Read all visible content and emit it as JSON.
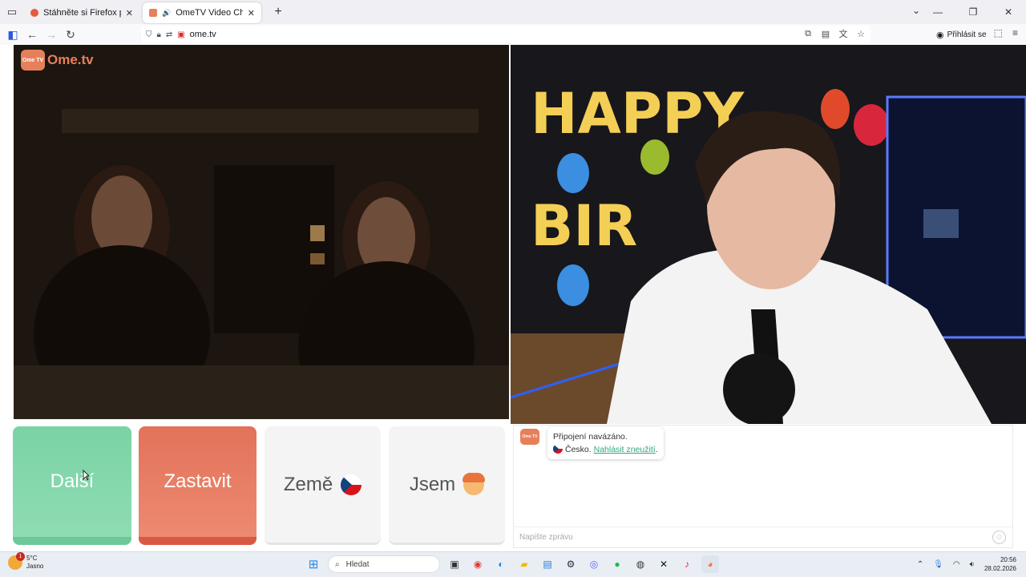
{
  "browser": {
    "tabs": [
      {
        "label": "Stáhněte si Firefox pro Android",
        "favicon_color": "#e55b3c"
      },
      {
        "label": "OmeTV Video Chat — Ome",
        "favicon_color": "#e6805b"
      }
    ],
    "url": "ome.tv",
    "signin_label": "Přihlásit se"
  },
  "video": {
    "logo_badge": "Ome TV",
    "logo_text": "Ome.tv"
  },
  "controls": {
    "next_label": "Další",
    "stop_label": "Zastavit",
    "country_label": "Země",
    "gender_label": "Jsem",
    "next_color": "#7ad3a5",
    "stop_color": "#e3725a"
  },
  "chat": {
    "avatar_label": "Ome TV",
    "system_line1": "Připojení navázáno.",
    "country_text": "Česko.",
    "report_link": "Nahlásit zneužití",
    "report_suffix": ".",
    "input_placeholder": "Napište zprávu"
  },
  "taskbar": {
    "weather_temp": "5°C",
    "weather_desc": "Jasno",
    "weather_badge": "1",
    "search_placeholder": "Hledat",
    "time": "20:56",
    "date": "28.02.2026"
  }
}
